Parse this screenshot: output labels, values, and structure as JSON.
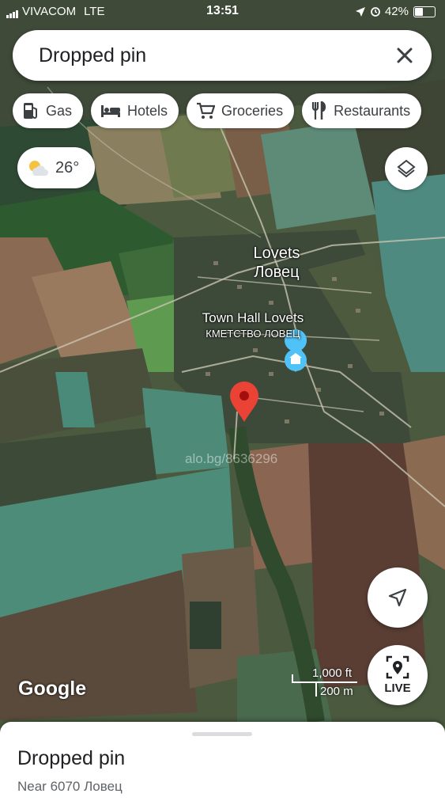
{
  "status_bar": {
    "carrier": "VIVACOM",
    "network": "LTE",
    "time": "13:51",
    "battery": "42%"
  },
  "search": {
    "query": "Dropped pin"
  },
  "chips": [
    {
      "label": "Gas",
      "icon": "gas-station-icon"
    },
    {
      "label": "Hotels",
      "icon": "bed-icon"
    },
    {
      "label": "Groceries",
      "icon": "cart-icon"
    },
    {
      "label": "Restaurants",
      "icon": "fork-knife-icon"
    }
  ],
  "weather": {
    "temperature": "26°",
    "icon": "partly-sunny-icon"
  },
  "map_labels": {
    "village_latin": "Lovets",
    "village_cyrillic": "Ловец",
    "poi_name": "Town Hall Lovets",
    "poi_name_local": "КМЕТСТВО ЛОВЕЦ"
  },
  "watermark": "alo.bg/8636296",
  "brand": "Google",
  "scale": {
    "imperial": "1,000 ft",
    "metric": "200 m"
  },
  "live_button": {
    "label": "LIVE"
  },
  "place_sheet": {
    "title": "Dropped pin",
    "subtitle": "Near 6070 Ловец"
  },
  "colors": {
    "pin": "#ea4335",
    "poi_marker": "#4fc3f7"
  }
}
